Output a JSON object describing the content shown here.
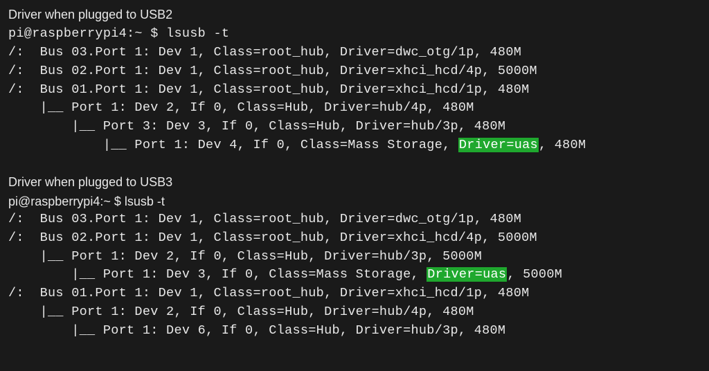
{
  "block1": {
    "header": "Driver when plugged to USB2",
    "prompt": "pi@raspberrypi4:~ $ lsusb -t",
    "lines": [
      {
        "pre": "/:  Bus 03.Port 1: Dev 1, Class=root_hub, Driver=dwc_otg/1p, 480M"
      },
      {
        "pre": "/:  Bus 02.Port 1: Dev 1, Class=root_hub, Driver=xhci_hcd/4p, 5000M"
      },
      {
        "pre": "/:  Bus 01.Port 1: Dev 1, Class=root_hub, Driver=xhci_hcd/1p, 480M"
      },
      {
        "pre": "    |__ Port 1: Dev 2, If 0, Class=Hub, Driver=hub/4p, 480M"
      },
      {
        "pre": "        |__ Port 3: Dev 3, If 0, Class=Hub, Driver=hub/3p, 480M"
      },
      {
        "pre": "            |__ Port 1: Dev 4, If 0, Class=Mass Storage, ",
        "hl": "Driver=uas",
        "post": ", 480M"
      }
    ]
  },
  "block2": {
    "header": "Driver when plugged to USB3",
    "prompt": "pi@raspberrypi4:~ $ lsusb -t",
    "lines": [
      {
        "pre": "/:  Bus 03.Port 1: Dev 1, Class=root_hub, Driver=dwc_otg/1p, 480M"
      },
      {
        "pre": "/:  Bus 02.Port 1: Dev 1, Class=root_hub, Driver=xhci_hcd/4p, 5000M"
      },
      {
        "pre": "    |__ Port 1: Dev 2, If 0, Class=Hub, Driver=hub/3p, 5000M"
      },
      {
        "pre": "        |__ Port 1: Dev 3, If 0, Class=Mass Storage, ",
        "hl": "Driver=uas",
        "post": ", 5000M"
      },
      {
        "pre": "/:  Bus 01.Port 1: Dev 1, Class=root_hub, Driver=xhci_hcd/1p, 480M"
      },
      {
        "pre": "    |__ Port 1: Dev 2, If 0, Class=Hub, Driver=hub/4p, 480M"
      },
      {
        "pre": "        |__ Port 1: Dev 6, If 0, Class=Hub, Driver=hub/3p, 480M"
      }
    ]
  }
}
